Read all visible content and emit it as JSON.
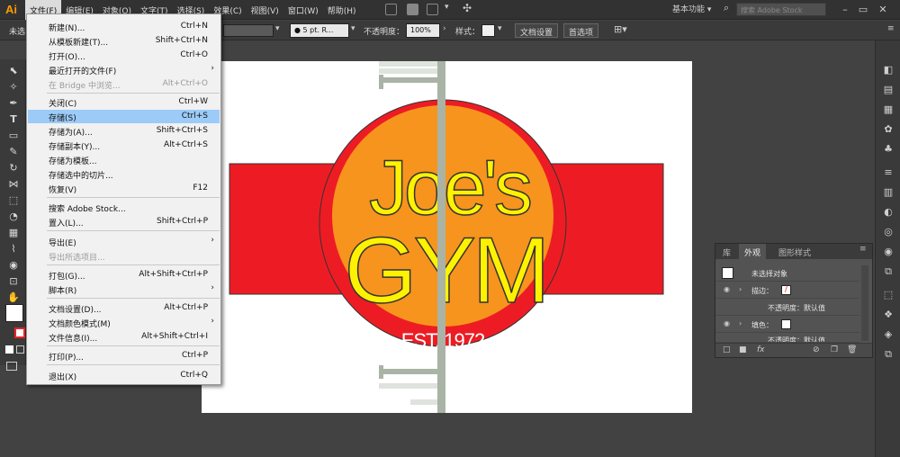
{
  "app": {
    "logo": "Ai"
  },
  "menubar": {
    "items": [
      "文件(F)",
      "编辑(E)",
      "对象(O)",
      "文字(T)",
      "选择(S)",
      "效果(C)",
      "视图(V)",
      "窗口(W)",
      "帮助(H)"
    ],
    "workspace": "基本功能",
    "search_placeholder": "搜索 Adobe Stock"
  },
  "controlbar": {
    "left_text": "未选",
    "stroke_weight": "5 pt. R...",
    "opacity_label": "不透明度：",
    "opacity_value": "100%",
    "style_label": "样式：",
    "doc_setup": "文档设置",
    "preferences": "首选项"
  },
  "file_menu": [
    {
      "label": "新建(N)...",
      "shortcut": "Ctrl+N"
    },
    {
      "label": "从模板新建(T)...",
      "shortcut": "Shift+Ctrl+N"
    },
    {
      "label": "打开(O)...",
      "shortcut": "Ctrl+O"
    },
    {
      "label": "最近打开的文件(F)",
      "shortcut": ""
    },
    {
      "label": "在 Bridge 中浏览...",
      "shortcut": "Alt+Ctrl+O"
    },
    {
      "label": "关闭(C)",
      "shortcut": "Ctrl+W"
    },
    {
      "label": "存储(S)",
      "shortcut": "Ctrl+S"
    },
    {
      "label": "存储为(A)...",
      "shortcut": "Shift+Ctrl+S"
    },
    {
      "label": "存储副本(Y)...",
      "shortcut": "Alt+Ctrl+S"
    },
    {
      "label": "存储为模板...",
      "shortcut": ""
    },
    {
      "label": "存储选中的切片...",
      "shortcut": ""
    },
    {
      "label": "恢复(V)",
      "shortcut": "F12"
    },
    {
      "label": "搜索 Adobe Stock...",
      "shortcut": ""
    },
    {
      "label": "置入(L)...",
      "shortcut": "Shift+Ctrl+P"
    },
    {
      "label": "导出(E)",
      "shortcut": ""
    },
    {
      "label": "导出所选项目...",
      "shortcut": ""
    },
    {
      "label": "打包(G)...",
      "shortcut": "Alt+Shift+Ctrl+P"
    },
    {
      "label": "脚本(R)",
      "shortcut": ""
    },
    {
      "label": "文档设置(D)...",
      "shortcut": "Alt+Ctrl+P"
    },
    {
      "label": "文档颜色模式(M)",
      "shortcut": ""
    },
    {
      "label": "文件信息(I)...",
      "shortcut": "Alt+Shift+Ctrl+I"
    },
    {
      "label": "打印(P)...",
      "shortcut": "Ctrl+P"
    },
    {
      "label": "退出(X)",
      "shortcut": "Ctrl+Q"
    }
  ],
  "artwork": {
    "line1": "Joe's",
    "line2": "GYM",
    "est": "EST. 1972",
    "colors": {
      "red": "#ed1c24",
      "orange": "#f7941d",
      "yellow": "#fff200",
      "bar": "#a9b3a6"
    }
  },
  "appearance_panel": {
    "tabs": [
      "库",
      "外观",
      "图形样式"
    ],
    "rows": [
      {
        "label": "未选择对象"
      },
      {
        "label": "描边："
      },
      {
        "label": "不透明度：默认值"
      },
      {
        "label": "填色："
      },
      {
        "label": "不透明度：默认值"
      }
    ]
  }
}
